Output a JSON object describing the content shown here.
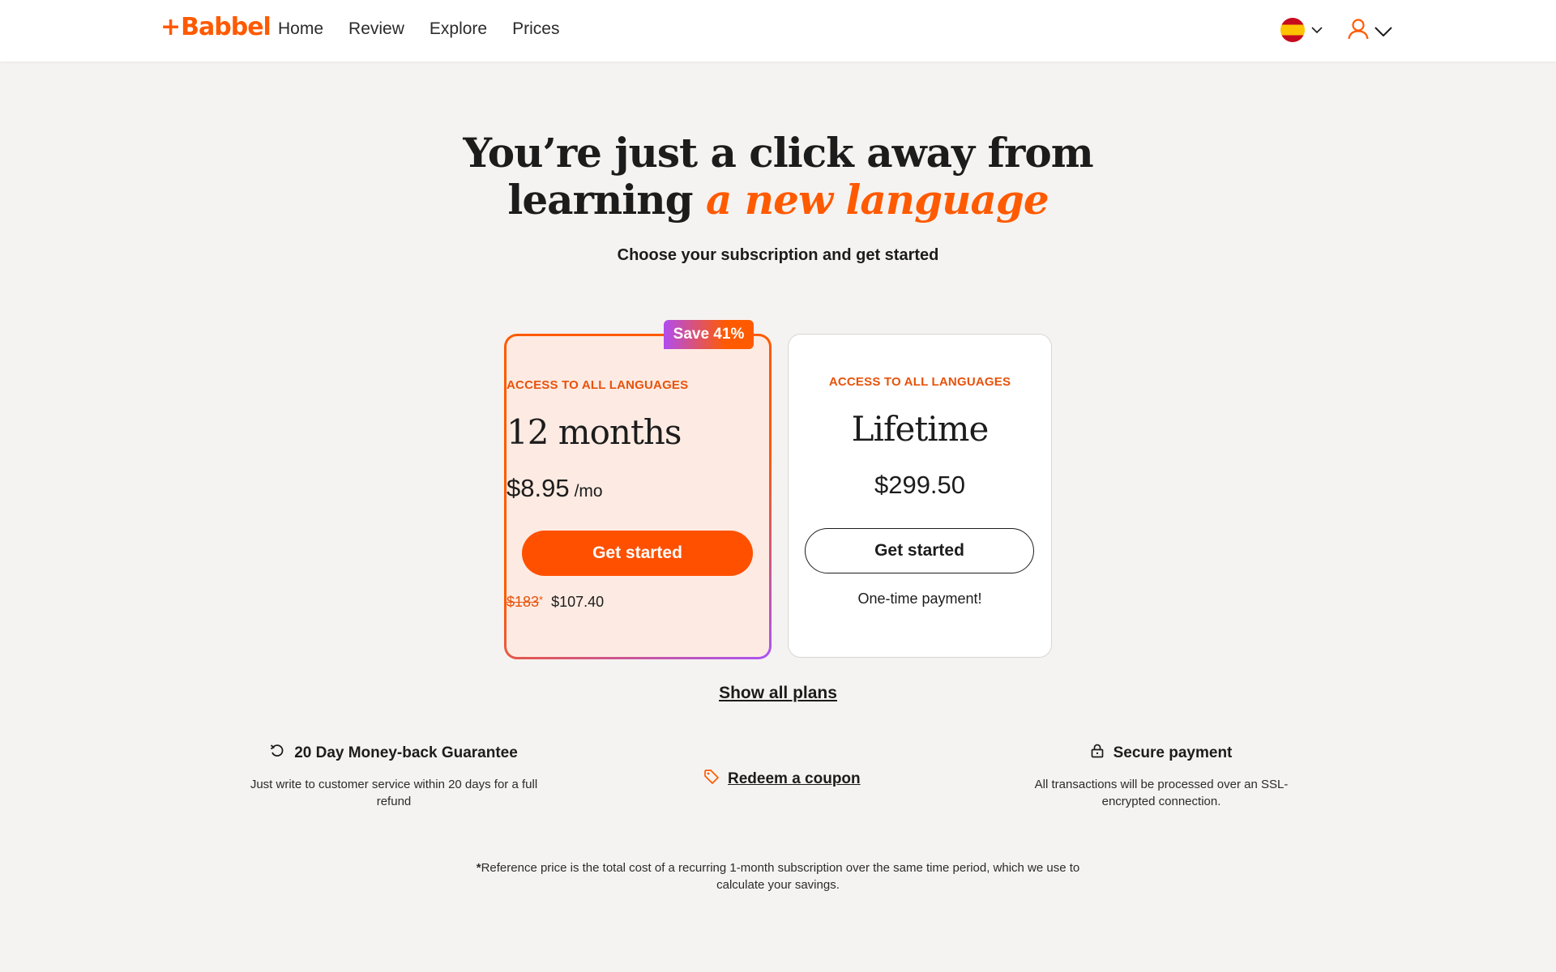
{
  "header": {
    "logo_plus": "+",
    "logo_text": "Babbel",
    "nav": [
      "Home",
      "Review",
      "Explore",
      "Prices"
    ],
    "language_flag": "spain-flag-icon",
    "account_icon": "user-icon"
  },
  "hero": {
    "title_line1": "You’re just a click away from",
    "title_line2_plain": "learning ",
    "title_line2_accent": "a new language",
    "subtitle": "Choose your subscription and get started"
  },
  "plans": {
    "twelve_months": {
      "badge": "Save 41%",
      "eyebrow": "ACCESS TO ALL LANGUAGES",
      "name": "12 months",
      "price": "$8.95",
      "per": "/mo",
      "cta": "Get started",
      "old_price": "$183",
      "old_price_marker": "*",
      "total_price": "$107.40"
    },
    "lifetime": {
      "eyebrow": "ACCESS TO ALL LANGUAGES",
      "name": "Lifetime",
      "price": "$299.50",
      "cta": "Get started",
      "note": "One-time payment!"
    }
  },
  "show_all_plans": "Show all plans",
  "trust": {
    "money_back_title": "20 Day Money-back Guarantee",
    "money_back_desc": "Just write to customer service within 20 days for a full refund",
    "coupon": "Redeem a coupon",
    "secure_title": "Secure payment",
    "secure_desc": "All transactions will be processed over an SSL-encrypted connection."
  },
  "footnote": {
    "marker": "*",
    "text": "Reference price is the total cost of a recurring 1-month subscription over the same time period, which we use to calculate your savings."
  },
  "colors": {
    "brand": "#ff5a00",
    "card_highlight_bg": "#fdebe3",
    "badge_gradient_start": "#b14cf0",
    "page_bg": "#f5f3f1"
  }
}
